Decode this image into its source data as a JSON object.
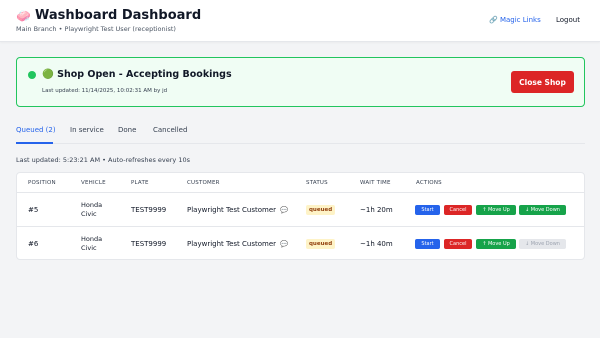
{
  "header": {
    "logo_icon": "🧼",
    "title": "Washboard Dashboard",
    "subtitle": "Main Branch • Playwright Test User (receptionist)",
    "magic_links": "🔗 Magic Links",
    "logout": "Logout"
  },
  "shop": {
    "status_text": "🟢 Shop Open - Accepting Bookings",
    "last_updated": "Last updated: 11/14/2025, 10:02:31 AM by jd",
    "close_button": "Close Shop",
    "status_color": "#22c55e"
  },
  "tabs": [
    "Queued (2)",
    "In service",
    "Done",
    "Cancelled"
  ],
  "refresh_text": "Last updated: 5:23:21 AM • Auto-refreshes every 10s",
  "table": {
    "columns": [
      "POSITION",
      "VEHICLE",
      "PLATE",
      "CUSTOMER",
      "STATUS",
      "WAIT TIME",
      "ACTIONS"
    ],
    "rows": [
      {
        "position": "#5",
        "vehicle": "Honda Civic",
        "plate": "TEST9999",
        "customer": "Playwright Test Customer",
        "chat_icon": "💬",
        "status": "queued",
        "wait": "~1h 20m",
        "actions": [
          "Start",
          "Cancel",
          "↑ Move Up",
          "↓ Move Down"
        ],
        "move_down_disabled": false
      },
      {
        "position": "#6",
        "vehicle": "Honda Civic",
        "plate": "TEST9999",
        "customer": "Playwright Test Customer",
        "chat_icon": "💬",
        "status": "queued",
        "wait": "~1h 40m",
        "actions": [
          "Start",
          "Cancel",
          "↑ Move Up",
          "↓ Move Down"
        ],
        "move_down_disabled": true
      }
    ]
  },
  "colors": {
    "primary": "#2563eb",
    "danger": "#dc2626",
    "success": "#16a34a",
    "badge_bg": "#fef3c7"
  }
}
